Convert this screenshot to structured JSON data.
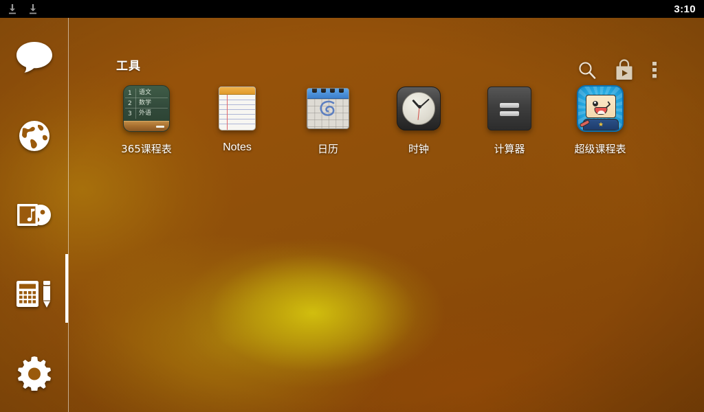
{
  "status_bar": {
    "notifications": [
      {
        "name": "download-icon-1",
        "glyph": "download"
      },
      {
        "name": "download-icon-2",
        "glyph": "download"
      }
    ],
    "clock": "3:10"
  },
  "sidebar": {
    "items": [
      {
        "id": "messaging",
        "icon": "speech-bubble-icon",
        "label": ""
      },
      {
        "id": "browser",
        "icon": "globe-icon",
        "label": ""
      },
      {
        "id": "media",
        "icon": "music-photo-icon",
        "label": ""
      },
      {
        "id": "tools",
        "icon": "calculator-pencil-icon",
        "label": "",
        "active": true
      },
      {
        "id": "settings",
        "icon": "gear-icon",
        "label": ""
      }
    ]
  },
  "header": {
    "title": "工具",
    "actions": [
      {
        "id": "search",
        "icon": "search-icon",
        "label": ""
      },
      {
        "id": "market",
        "icon": "play-store-bag-icon",
        "label": ""
      },
      {
        "id": "overflow",
        "icon": "overflow-menu-icon",
        "label": ""
      }
    ]
  },
  "apps": [
    {
      "id": "schedule365",
      "label": "365课程表",
      "icon": "blackboard-icon",
      "board_rows": [
        {
          "num": "1",
          "subject": "语文"
        },
        {
          "num": "2",
          "subject": "数学"
        },
        {
          "num": "3",
          "subject": "外语"
        }
      ]
    },
    {
      "id": "notes",
      "label": "Notes",
      "icon": "notepad-icon",
      "script": "latin"
    },
    {
      "id": "calendar",
      "label": "日历",
      "icon": "calendar-icon"
    },
    {
      "id": "clock",
      "label": "时钟",
      "icon": "analog-clock-icon"
    },
    {
      "id": "calculator",
      "label": "计算器",
      "icon": "calculator-icon"
    },
    {
      "id": "superclass",
      "label": "超级课程表",
      "icon": "winking-face-icon"
    }
  ],
  "colors": {
    "status_bar_bg": "#000000",
    "wallpaper_base": "#95520a",
    "wallpaper_highlight": "#c9b30e",
    "wallpaper_deep": "#7e4206",
    "sidebar_icon": "#ffffff",
    "divider": "#ffffff",
    "label_text": "#ffffff"
  }
}
